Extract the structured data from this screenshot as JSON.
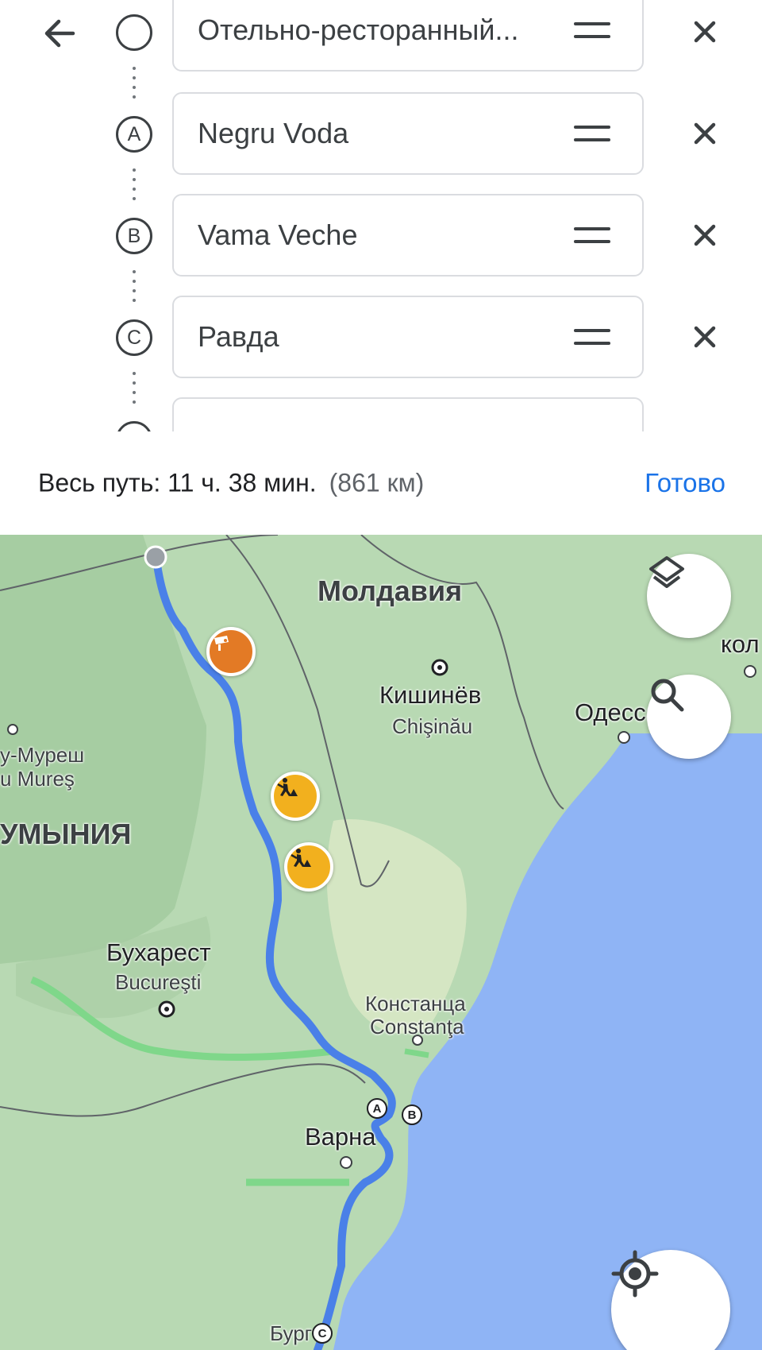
{
  "stops": [
    {
      "marker": "",
      "value": "Отельно-ресторанный..."
    },
    {
      "marker": "A",
      "value": "Negru Voda"
    },
    {
      "marker": "B",
      "value": "Vama Veche"
    },
    {
      "marker": "C",
      "value": "Равда"
    },
    {
      "marker": "",
      "value": ""
    }
  ],
  "summary": {
    "total": "Весь путь: 11 ч. 38 мин.",
    "distance": "(861 км)",
    "done": "Готово"
  },
  "map": {
    "countries": {
      "moldova": "Молдавия",
      "romania": "УМЫНИЯ"
    },
    "cities": {
      "chisinau": "Кишинёв",
      "chisinau_local": "Chişinău",
      "odessa": "Одесса",
      "bucharest": "Бухарест",
      "bucharest_local": "Bucureşti",
      "constanta": "Констанца",
      "constanta_local": "Constanţa",
      "varna": "Варна",
      "burgas": "Бург",
      "targu_mures": "у-Муреш",
      "targu_mures_local": "u Mureş",
      "nikolaev": "кол"
    },
    "waypoint_markers": [
      "A",
      "B",
      "C"
    ],
    "alert_icons": [
      "speed-camera-icon",
      "roadworks-icon",
      "roadworks-icon"
    ]
  },
  "colors": {
    "accent": "#1a73e8",
    "route": "#4a80e8",
    "sea": "#8fb4f5",
    "land": "#b8d9b3",
    "camera": "#e37a25",
    "roadworks": "#f2b01e"
  }
}
